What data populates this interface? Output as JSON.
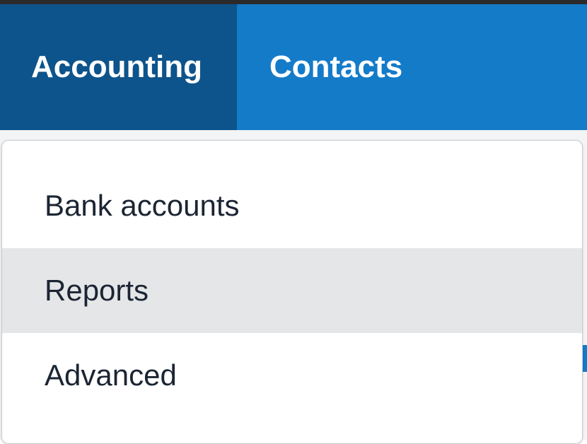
{
  "nav": {
    "tabs": [
      {
        "label": "Accounting",
        "active": true
      },
      {
        "label": "Contacts",
        "active": false
      }
    ]
  },
  "dropdown": {
    "items": [
      {
        "label": "Bank accounts",
        "highlighted": false
      },
      {
        "label": "Reports",
        "highlighted": true
      },
      {
        "label": "Advanced",
        "highlighted": false
      }
    ]
  },
  "colors": {
    "nav_background": "#147bc9",
    "nav_active_tab": "#0d548c",
    "menu_highlight": "#e5e6e8",
    "menu_text": "#1b2533"
  }
}
